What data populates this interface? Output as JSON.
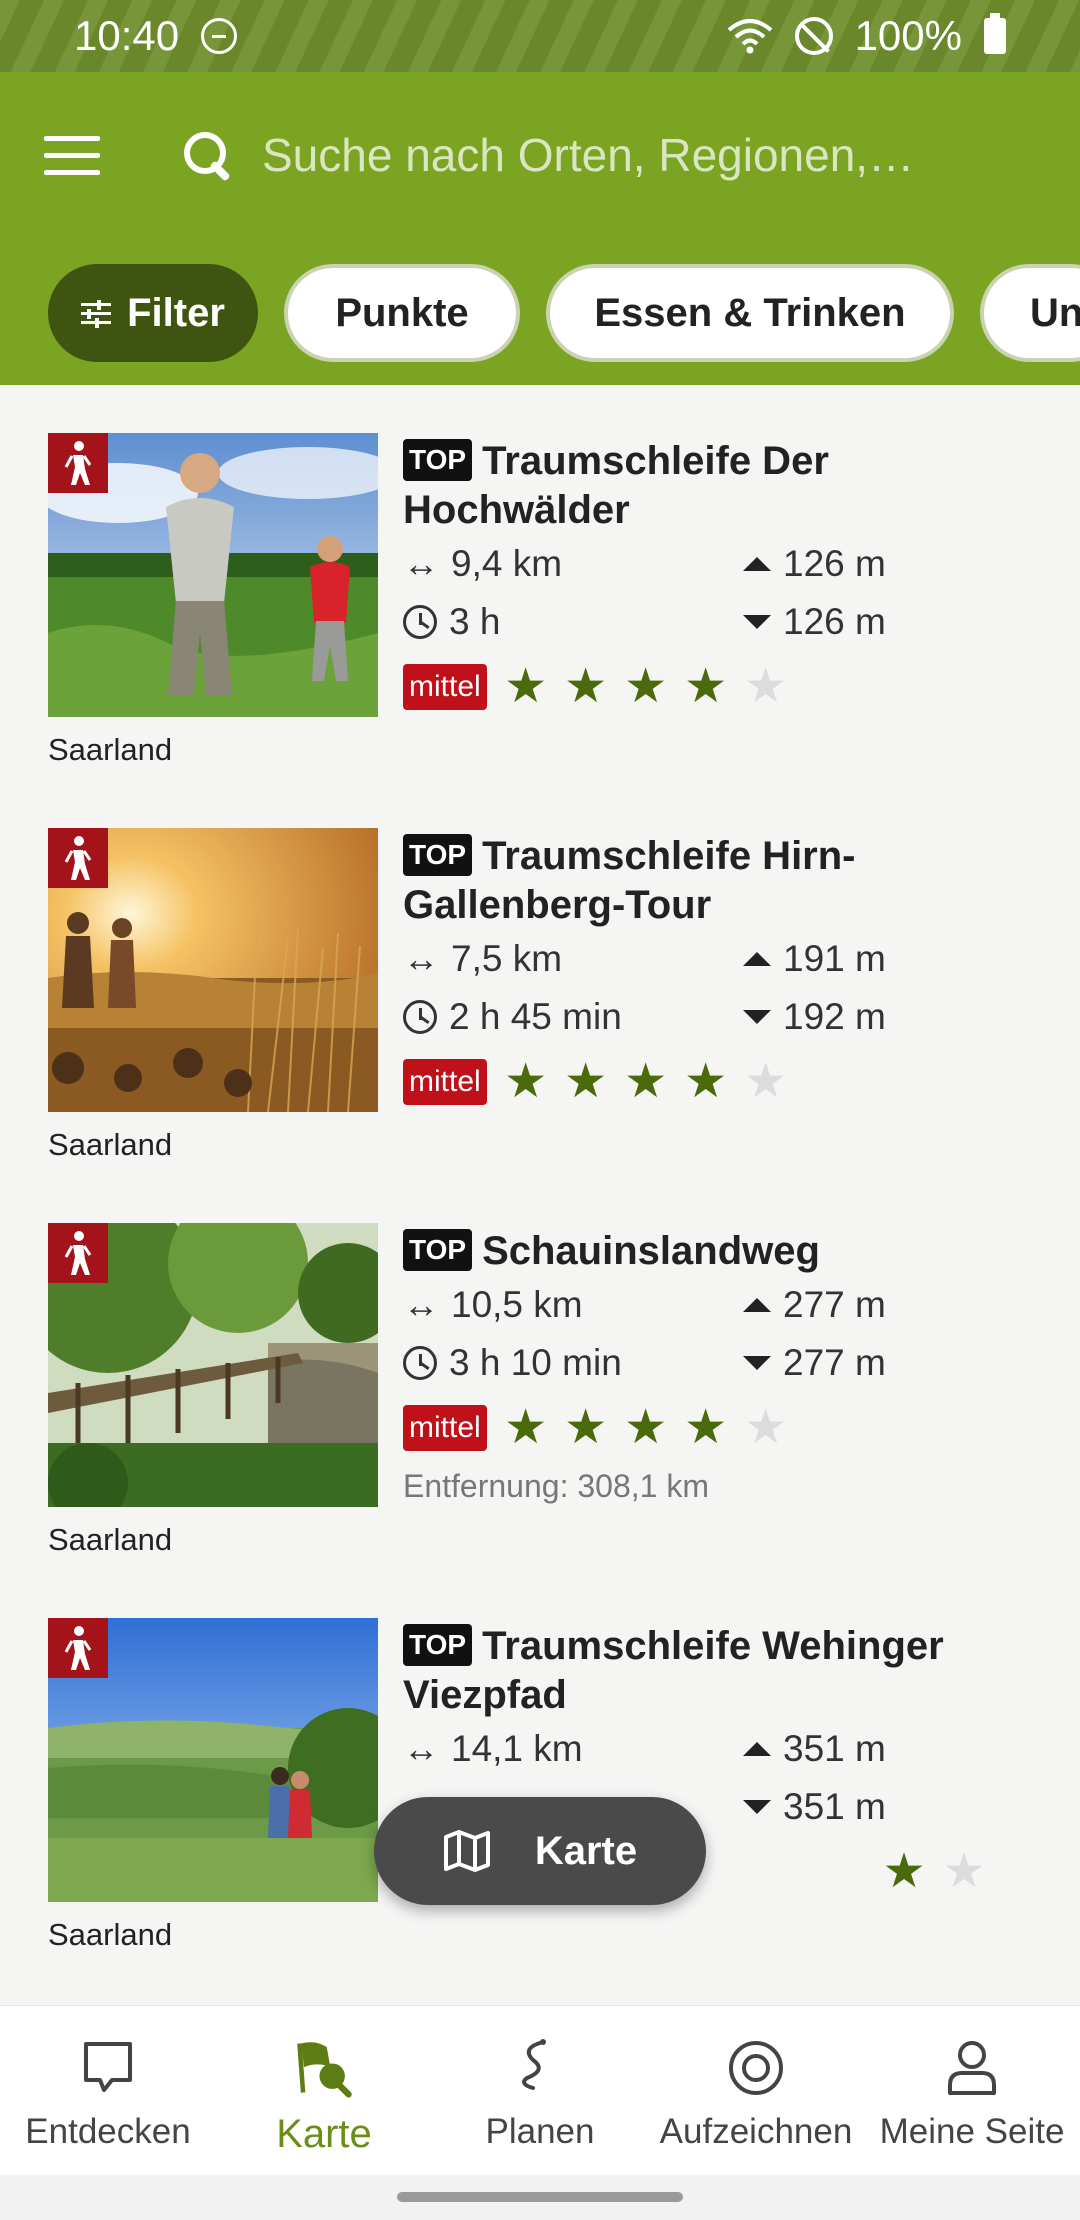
{
  "status_bar": {
    "time": "10:40",
    "battery": "100%"
  },
  "search": {
    "placeholder": "Suche nach Orten, Regionen,…"
  },
  "chips": [
    {
      "label": "Filter"
    },
    {
      "label": "Punkte"
    },
    {
      "label": "Essen & Trinken"
    },
    {
      "label": "Un"
    }
  ],
  "tours": [
    {
      "badge": "TOP",
      "title": "Traumschleife Der Hochwälder",
      "distance": "9,4 km",
      "duration": "3 h",
      "ascent": "126 m",
      "descent": "126 m",
      "difficulty": "mittel",
      "stars": 4,
      "region": "Saarland"
    },
    {
      "badge": "TOP",
      "title": "Traumschleife Hirn-Gallenberg-Tour",
      "distance": "7,5 km",
      "duration": "2 h 45 min",
      "ascent": "191 m",
      "descent": "192 m",
      "difficulty": "mittel",
      "stars": 4,
      "region": "Saarland"
    },
    {
      "badge": "TOP",
      "title": "Schauinslandweg",
      "distance": "10,5 km",
      "duration": "3 h 10 min",
      "ascent": "277 m",
      "descent": "277 m",
      "difficulty": "mittel",
      "stars": 4,
      "region": "Saarland",
      "distance_away": "Entfernung: 308,1 km"
    },
    {
      "badge": "TOP",
      "title": "Traumschleife Wehinger Viezpfad",
      "distance": "14,1 km",
      "ascent": "351 m",
      "descent": "351 m",
      "stars": 4,
      "region": "Saarland"
    }
  ],
  "map_button": {
    "label": "Karte"
  },
  "bottom_nav": [
    {
      "label": "Entdecken",
      "icon": "speech-bubble-icon"
    },
    {
      "label": "Karte",
      "icon": "map-flag-search-icon",
      "active": true
    },
    {
      "label": "Planen",
      "icon": "route-icon"
    },
    {
      "label": "Aufzeichnen",
      "icon": "record-icon"
    },
    {
      "label": "Meine Seite",
      "icon": "user-icon"
    }
  ],
  "colors": {
    "header": "#7aa421",
    "filter_chip": "#3f5410",
    "star": "#4a6a0c",
    "difficulty": "#c0101a",
    "hike_badge": "#a5131a",
    "active_nav": "#6b8e16"
  }
}
